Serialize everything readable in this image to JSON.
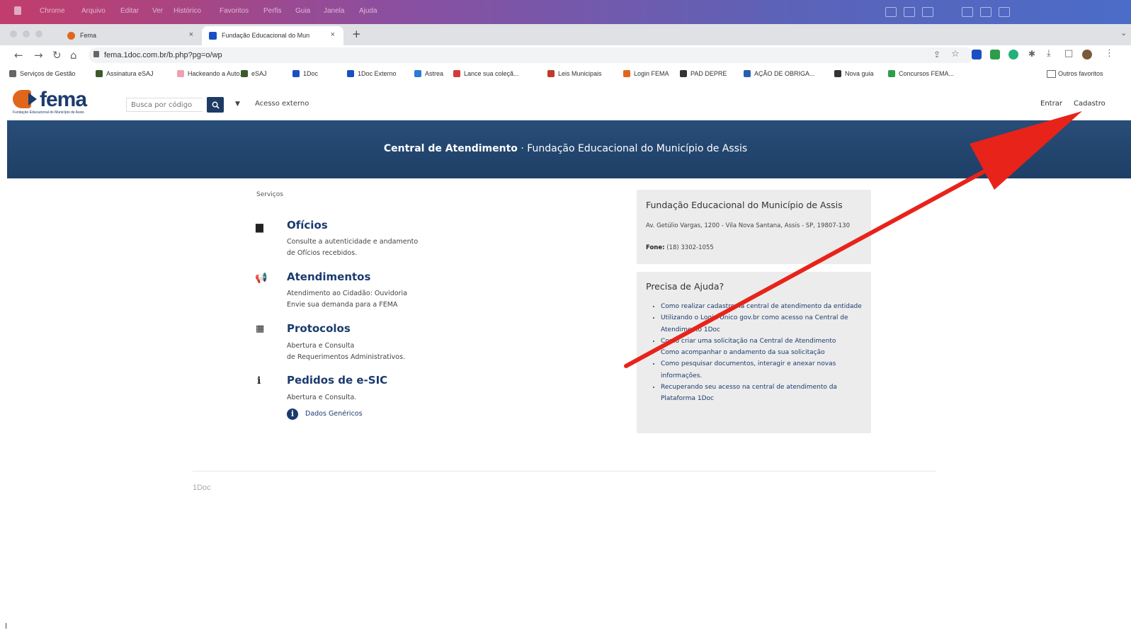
{
  "menubar": {
    "items": [
      "Chrome",
      "Arquivo",
      "Editar",
      "Ver",
      "Histórico",
      "Favoritos",
      "Perfis",
      "Guia",
      "Janela",
      "Ajuda"
    ]
  },
  "tabs": [
    {
      "title": "Fema",
      "favicon_color": "#e0661c"
    },
    {
      "title": "Fundação Educacional do Mun",
      "favicon_color": "#1a4fc4"
    }
  ],
  "tab_close_glyph": "×",
  "newtab_glyph": "+",
  "addressbar": {
    "url": "fema.1doc.com.br/b.php?pg=o/wp"
  },
  "bookmarks": [
    {
      "label": "Serviços de Gestão",
      "color": "#666666"
    },
    {
      "label": "Assinatura eSAJ",
      "color": "#3a5a2a"
    },
    {
      "label": "Hackeando a Auto...",
      "color": "#f0a0b0"
    },
    {
      "label": "eSAJ",
      "color": "#3a5a2a"
    },
    {
      "label": "1Doc",
      "color": "#1a4fc4"
    },
    {
      "label": "1Doc Externo",
      "color": "#1a4fc4"
    },
    {
      "label": "Astrea",
      "color": "#2a7ad8"
    },
    {
      "label": "Lance sua coleçã...",
      "color": "#d43a3a"
    },
    {
      "label": "Leis Municipais",
      "color": "#c0392b"
    },
    {
      "label": "Login FEMA",
      "color": "#e0661c"
    },
    {
      "label": "PAD DEPRE",
      "color": "#333333"
    },
    {
      "label": "AÇÃO DE OBRIGA...",
      "color": "#2a5fb0"
    },
    {
      "label": "Nova guia",
      "color": "#333333"
    },
    {
      "label": "Concursos FEMA...",
      "color": "#2e9d4a"
    }
  ],
  "bookmarks_other": "Outros favoritos",
  "site": {
    "logo_text": "fema",
    "logo_sub": "Fundação Educacional do Município de Assis",
    "search_placeholder": "Busca por código",
    "acesso": "Acesso externo",
    "entrar": "Entrar",
    "cadastro": "Cadastro"
  },
  "hero": {
    "title_bold": "Central de Atendimento",
    "title_rest": " · Fundação Educacional do Município de Assis"
  },
  "services": {
    "label": "Serviços",
    "items": [
      {
        "icon": "document-icon",
        "title": "Ofícios",
        "lines": [
          "Consulte a autenticidade e andamento",
          "de Ofícios recebidos."
        ]
      },
      {
        "icon": "megaphone-icon",
        "title": "Atendimentos",
        "lines": [
          "Atendimento ao Cidadão: Ouvidoria",
          "Envie sua demanda para a FEMA"
        ]
      },
      {
        "icon": "qrcode-icon",
        "title": "Protocolos",
        "lines": [
          "Abertura e Consulta",
          "de Requerimentos Administrativos."
        ]
      },
      {
        "icon": "info-icon",
        "title": "Pedidos de e-SIC",
        "lines": [
          "Abertura e Consulta."
        ]
      }
    ],
    "dados": "Dados Genéricos"
  },
  "contact": {
    "title": "Fundação Educacional do Município de Assis",
    "address": "Av. Getúlio Vargas, 1200 - Vila Nova Santana, Assis - SP, 19807-130",
    "fone_label": "Fone:",
    "fone_value": " (18) 3302-1055"
  },
  "help": {
    "title": "Precisa de Ajuda?",
    "links": [
      "Como realizar cadastro na central de atendimento da entidade",
      "Utilizando o Login Único gov.br como acesso na Central de Atendimento 1Doc",
      "Como criar uma solicitação na Central de Atendimento",
      "Como acompanhar o andamento da sua solicitação",
      "Como pesquisar documentos, interagir e anexar novas informações.",
      "Recuperando seu acesso na central de atendimento da Plataforma 1Doc"
    ]
  },
  "footer": {
    "text": "1Doc"
  },
  "annotation": {
    "arrow_color": "#e8231a"
  }
}
